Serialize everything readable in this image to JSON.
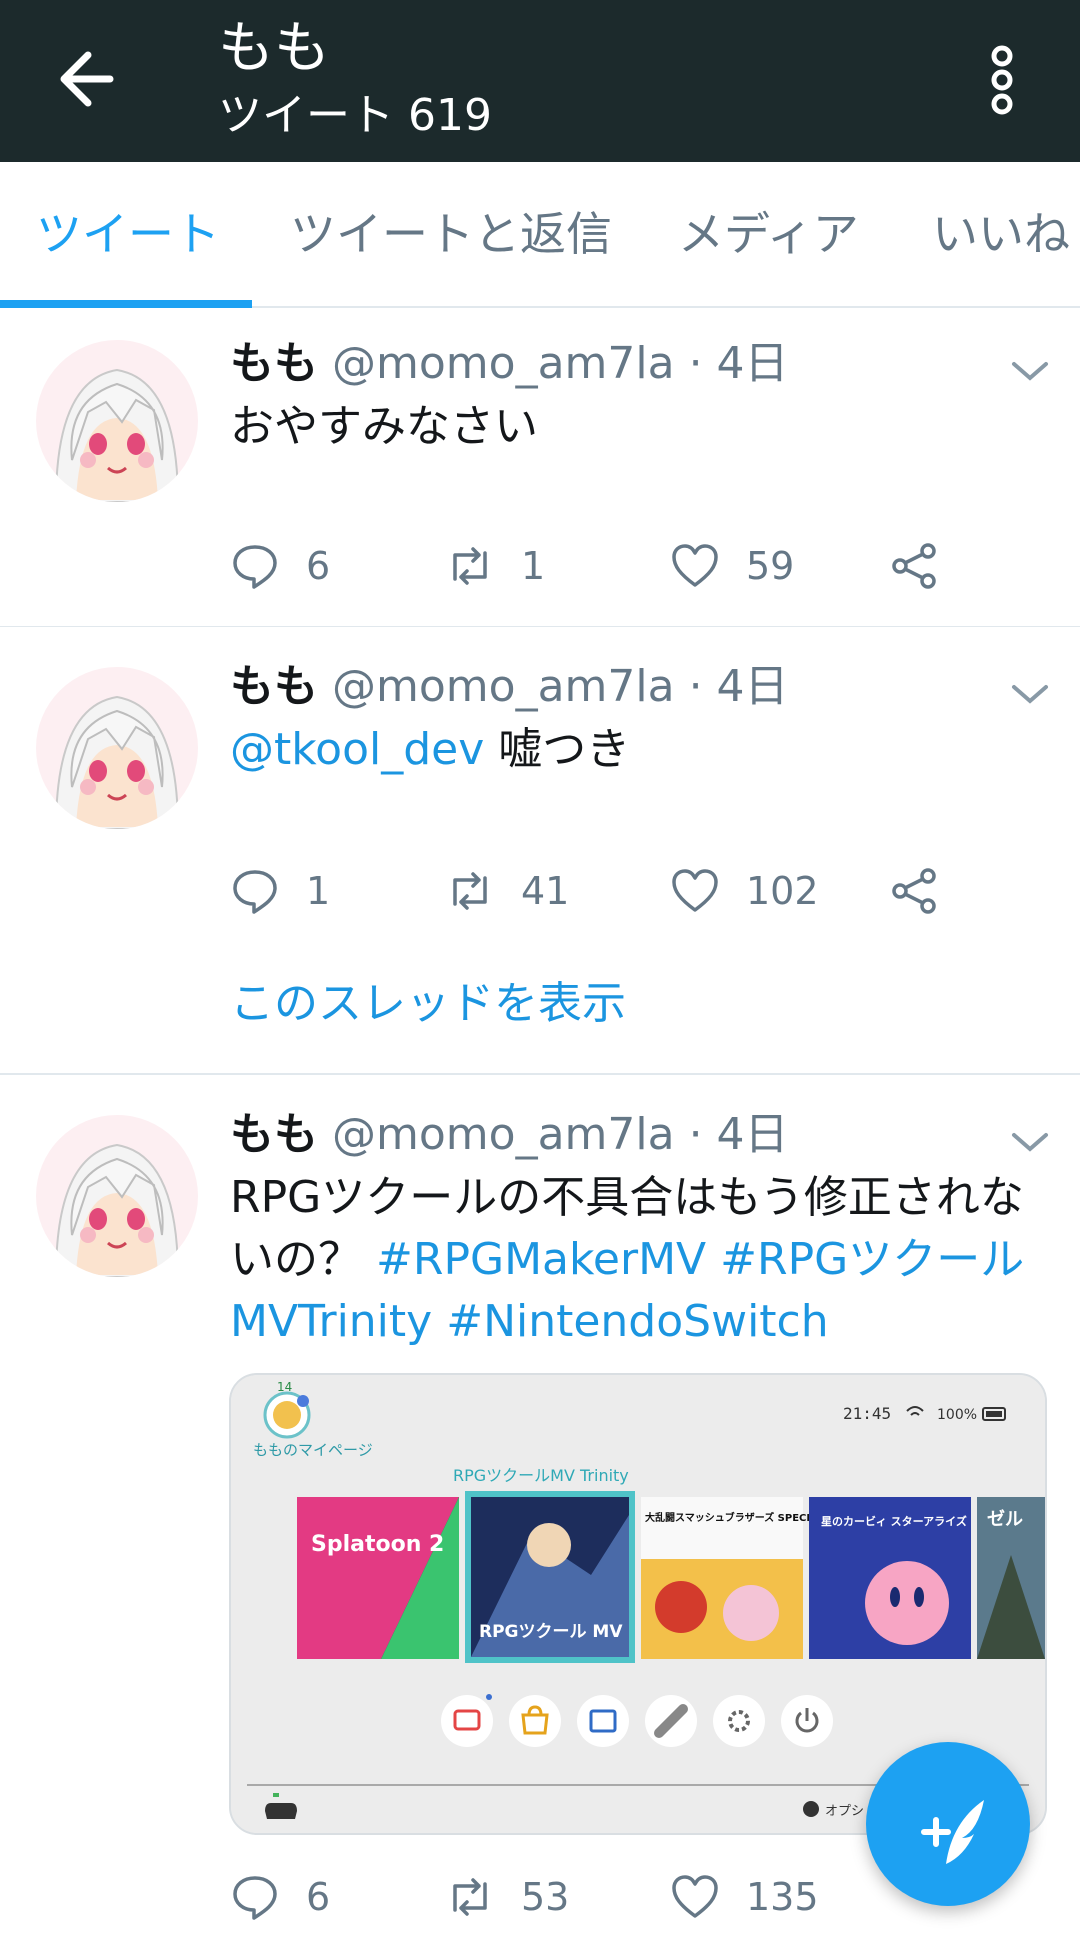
{
  "header": {
    "title": "もも",
    "subtitle": "ツイート 619"
  },
  "tabs": [
    {
      "label": "ツイート"
    },
    {
      "label": "ツイートと返信"
    },
    {
      "label": "メディア"
    },
    {
      "label": "いいね"
    }
  ],
  "tweets": [
    {
      "name": "もも",
      "handle": "@momo_am7la",
      "time": "· 4日",
      "text": "おやすみなさい",
      "replies": "6",
      "retweets": "1",
      "likes": "59"
    },
    {
      "name": "もも",
      "handle": "@momo_am7la",
      "time": "· 4日",
      "mention": "@tkool_dev",
      "text": " 嘘つき",
      "replies": "1",
      "retweets": "41",
      "likes": "102",
      "thread_link": "このスレッドを表示"
    },
    {
      "name": "もも",
      "handle": "@momo_am7la",
      "time": "· 4日",
      "text": "RPGツクールの不具合はもう修正されないの？",
      "hashtags": [
        "#RPGMakerMV",
        "#RPGツクールMVTrinity",
        "#NintendoSwitch"
      ],
      "replies": "6",
      "retweets": "53",
      "likes": "135"
    }
  ],
  "media": {
    "badge": "14",
    "profile_label": "もものマイページ",
    "time": "21:45",
    "battery": "100%",
    "selected_game": "RPGツクールMV Trinity",
    "games": [
      {
        "label": "Splatoon 2"
      },
      {
        "label": "RPGツクール MV"
      },
      {
        "label": "大乱闘スマッシュブラザーズ SPECIAL"
      },
      {
        "label": "星のカービィ スターアライズ"
      },
      {
        "label": "ゼル"
      }
    ],
    "options_label": "オプシ"
  }
}
